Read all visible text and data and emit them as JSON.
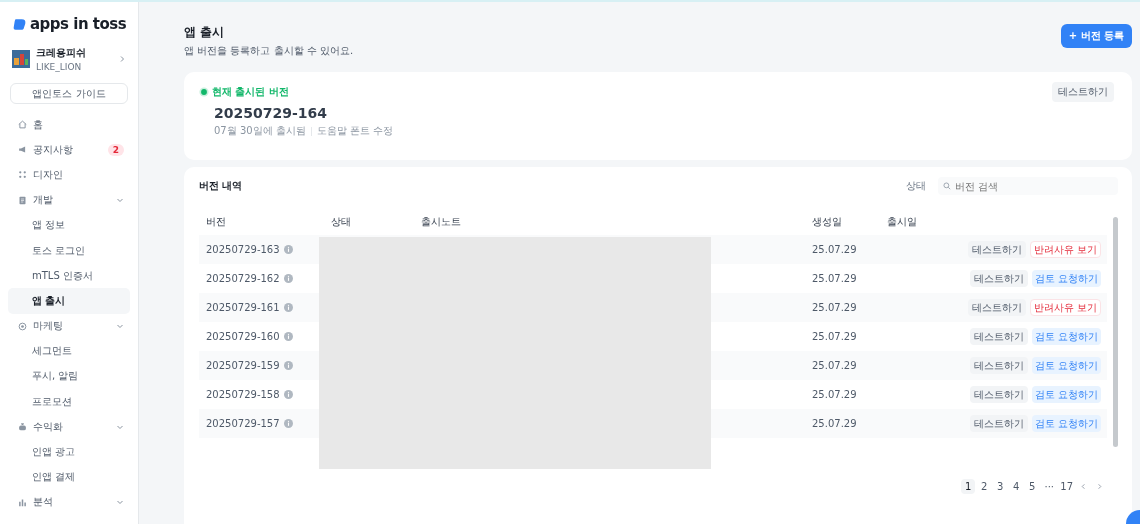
{
  "brand": {
    "name": "apps in toss"
  },
  "workspace": {
    "name": "크레용피쉬",
    "org": "LIKE_LION"
  },
  "guide_button": "앱인토스 가이드",
  "sidebar": {
    "items": [
      {
        "label": "홈",
        "selected": false
      },
      {
        "label": "공지사항",
        "selected": false,
        "badge": "2"
      },
      {
        "label": "디자인",
        "selected": false
      },
      {
        "label": "개발",
        "selected": false,
        "children": [
          {
            "label": "앱 정보",
            "selected": false
          },
          {
            "label": "토스 로그인",
            "selected": false
          },
          {
            "label": "mTLS 인증서",
            "selected": false
          },
          {
            "label": "앱 출시",
            "selected": true
          }
        ]
      },
      {
        "label": "마케팅",
        "selected": false,
        "children": [
          {
            "label": "세그먼트",
            "selected": false
          },
          {
            "label": "푸시, 알림",
            "selected": false
          },
          {
            "label": "프로모션",
            "selected": false
          }
        ]
      },
      {
        "label": "수익화",
        "selected": false,
        "children": [
          {
            "label": "인앱 광고",
            "selected": false
          },
          {
            "label": "인앱 결제",
            "selected": false
          }
        ]
      },
      {
        "label": "분석",
        "selected": false
      }
    ]
  },
  "page": {
    "title": "앱 출시",
    "subtitle": "앱 버전을 등록하고 출시할 수 있어요.",
    "primary_button": "+ 버전 등록"
  },
  "current": {
    "label": "현재 출시된 버전",
    "version": "20250729-164",
    "released": "07월 30일에 출시됨",
    "note": "도움말 폰트 수정",
    "test_button": "테스트하기"
  },
  "history": {
    "title": "버전 내역",
    "filter_label": "상태",
    "search": {
      "placeholder": "버전 검색"
    },
    "table": {
      "redacted": true,
      "columns": [
        "버전",
        "상태",
        "출시노트",
        "생성일",
        "출시일"
      ],
      "rows": [
        {
          "version": "20250729-163",
          "created": "25.07.29",
          "test": "테스트하기",
          "action": {
            "kind": "reject",
            "label": "반려사유 보기"
          }
        },
        {
          "version": "20250729-162",
          "created": "25.07.29",
          "test": "테스트하기",
          "action": {
            "kind": "review",
            "label": "검토 요청하기"
          }
        },
        {
          "version": "20250729-161",
          "created": "25.07.29",
          "test": "테스트하기",
          "action": {
            "kind": "reject",
            "label": "반려사유 보기"
          }
        },
        {
          "version": "20250729-160",
          "created": "25.07.29",
          "test": "테스트하기",
          "action": {
            "kind": "review",
            "label": "검토 요청하기"
          }
        },
        {
          "version": "20250729-159",
          "created": "25.07.29",
          "test": "테스트하기",
          "action": {
            "kind": "review",
            "label": "검토 요청하기"
          }
        },
        {
          "version": "20250729-158",
          "created": "25.07.29",
          "test": "테스트하기",
          "action": {
            "kind": "review",
            "label": "검토 요청하기"
          }
        },
        {
          "version": "20250729-157",
          "created": "25.07.29",
          "test": "테스트하기",
          "action": {
            "kind": "review",
            "label": "검토 요청하기"
          }
        }
      ]
    },
    "pagination": {
      "pages": [
        {
          "label": "1",
          "selected": true
        },
        {
          "label": "2",
          "selected": false
        },
        {
          "label": "3",
          "selected": false
        },
        {
          "label": "4",
          "selected": false
        },
        {
          "label": "5",
          "selected": false
        }
      ],
      "ellipsis": "···",
      "last": {
        "label": "17",
        "selected": false
      }
    }
  }
}
